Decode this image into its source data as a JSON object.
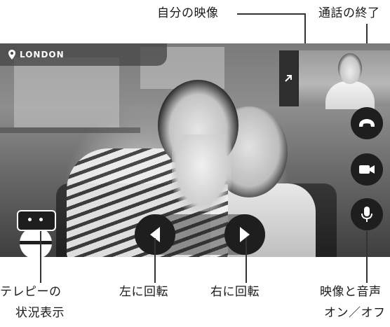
{
  "callouts": {
    "self_view": "自分の映像",
    "end_call": "通話の終了",
    "telepresence_status": [
      "テレピーの",
      "状況表示"
    ],
    "rotate_left": "左に回転",
    "rotate_right": "右に回転",
    "media_toggle": [
      "映像と音声",
      "オン／オフ"
    ]
  },
  "location": {
    "label": "LONDON",
    "icon": "pin-icon"
  },
  "controls": {
    "expand_icon": "expand-arrow-icon",
    "end_call_icon": "phone-hangup-icon",
    "video_icon": "video-camera-icon",
    "mic_icon": "microphone-icon",
    "rotate_left_icon": "triangle-left-icon",
    "rotate_right_icon": "triangle-right-icon"
  },
  "colors": {
    "control_bg": "#1e1e1e",
    "badge_bg": "#464646",
    "text": "#1a1a1a"
  }
}
